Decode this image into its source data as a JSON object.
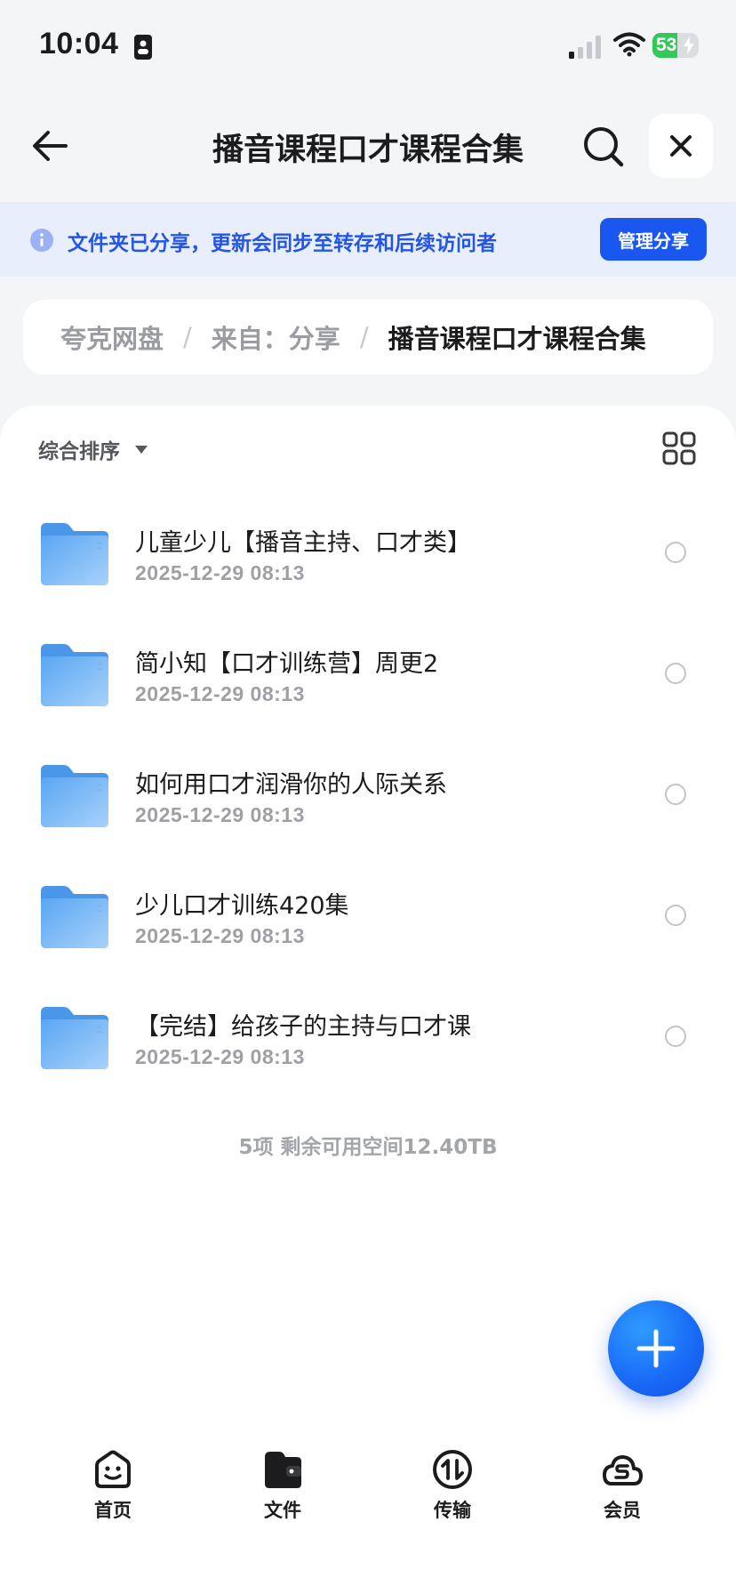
{
  "status_bar": {
    "time": "10:04",
    "battery_level": 53,
    "battery_text": "53"
  },
  "header": {
    "title": "播音课程口才课程合集",
    "back_icon": "arrow-left-icon",
    "search_icon": "search-icon",
    "close_icon": "close-icon"
  },
  "share_banner": {
    "icon": "info-icon",
    "text": "文件夹已分享，更新会同步至转存和后续访问者",
    "button_label": "管理分享",
    "accent_color": "#1a56f0"
  },
  "breadcrumb": {
    "items": [
      "夸克网盘",
      "来自：分享"
    ],
    "current": "播音课程口才课程合集",
    "separator": "/"
  },
  "toolbar": {
    "sort_label": "综合排序",
    "sort_icon": "caret-down-icon",
    "view_icon": "grid-view-icon"
  },
  "files": [
    {
      "name": "儿童少儿【播音主持、口才类】",
      "date": "2025-12-29 08:13",
      "type": "folder"
    },
    {
      "name": "简小知【口才训练营】周更2",
      "date": "2025-12-29 08:13",
      "type": "folder"
    },
    {
      "name": "如何用口才润滑你的人际关系",
      "date": "2025-12-29 08:13",
      "type": "folder"
    },
    {
      "name": "少儿口才训练420集",
      "date": "2025-12-29 08:13",
      "type": "folder"
    },
    {
      "name": "【完结】给孩子的主持与口才课",
      "date": "2025-12-29 08:13",
      "type": "folder"
    }
  ],
  "footer": {
    "summary": "5项 剩余可用空间12.40TB"
  },
  "fab": {
    "icon": "plus-icon"
  },
  "tabs": [
    {
      "label": "首页",
      "icon": "home-smile-icon"
    },
    {
      "label": "文件",
      "icon": "folder-wallet-icon"
    },
    {
      "label": "传输",
      "icon": "transfer-icon"
    },
    {
      "label": "会员",
      "icon": "member-cloud-icon"
    }
  ]
}
